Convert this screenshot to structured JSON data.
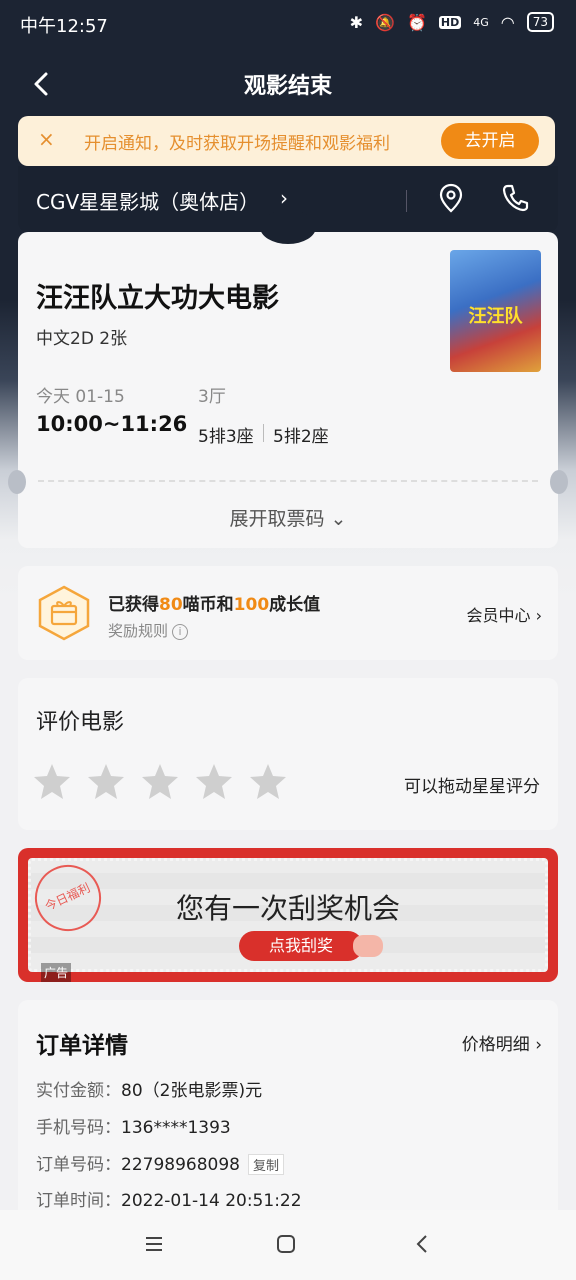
{
  "status_bar": {
    "time": "中午12:57",
    "battery": "73",
    "network": "4G",
    "hd_badge": "HD"
  },
  "nav": {
    "title": "观影结束"
  },
  "notify": {
    "close": "×",
    "text": "开启通知，及时获取开场提醒和观影福利",
    "button": "去开启"
  },
  "cinema": {
    "name": "CGV星星影城（奥体店）",
    "arrow": "›"
  },
  "ticket": {
    "movie_title": "汪汪队立大功大电影",
    "format": "中文2D 2张",
    "date": "今天 01-15",
    "time": "10:00~11:26",
    "hall": "3厅",
    "seats": [
      "5排3座",
      "5排2座"
    ],
    "expand": "展开取票码 ⌄",
    "poster_text": "汪汪队"
  },
  "reward": {
    "pre": "已获得",
    "coins": "80",
    "mid": "喵币和",
    "growth": "100",
    "post": "成长值",
    "rule": "奖励规则",
    "info": "i",
    "member": "会员中心 ›"
  },
  "rating": {
    "title": "评价电影",
    "hint": "可以拖动星星评分",
    "stars_max": 5,
    "stars_value": 0
  },
  "scratch": {
    "stamp": "今日福利",
    "title": "您有一次刮奖机会",
    "button": "点我刮奖",
    "ad": "广告"
  },
  "order": {
    "title": "订单详情",
    "price_detail": "价格明细 ›",
    "rows": [
      {
        "key": "实付金额：",
        "value": "80（2张电影票)元"
      },
      {
        "key": "手机号码：",
        "value": "136****1393"
      },
      {
        "key": "订单号码：",
        "value": "22798968098"
      },
      {
        "key": "订单时间：",
        "value": "2022-01-14 20:51:22"
      }
    ],
    "copy": "复制"
  },
  "colors": {
    "accent": "#f08a15",
    "dark_bg": "#1c2433",
    "scratch_red": "#d9302b"
  }
}
